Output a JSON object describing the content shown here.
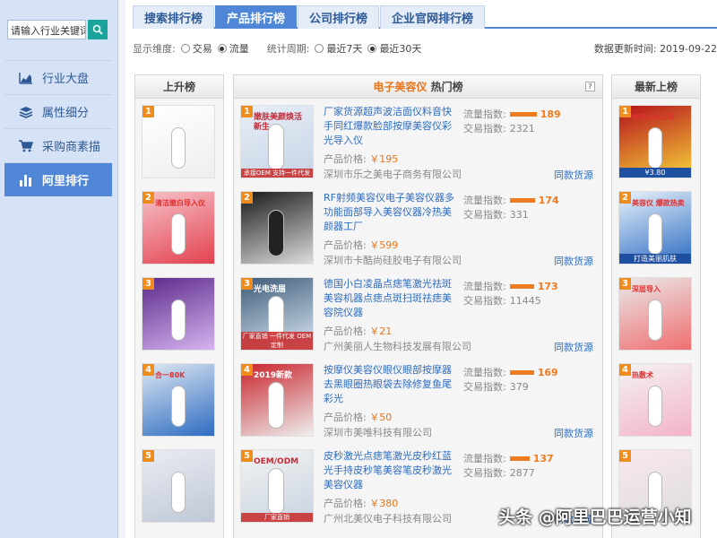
{
  "sidebar": {
    "search_placeholder": "请输入行业关键词",
    "items": [
      {
        "label": "行业大盘",
        "icon": "area-chart-icon"
      },
      {
        "label": "属性细分",
        "icon": "layers-icon"
      },
      {
        "label": "采购商素描",
        "icon": "cart-icon"
      },
      {
        "label": "阿里排行",
        "icon": "bar-chart-icon",
        "active": true
      }
    ]
  },
  "tabs": [
    "搜索排行榜",
    "产品排行榜",
    "公司排行榜",
    "企业官网排行榜"
  ],
  "active_tab": "产品排行榜",
  "filters": {
    "dimension_label": "显示维度:",
    "dimension_options": [
      "交易",
      "流量"
    ],
    "dimension_selected": "流量",
    "period_label": "统计周期:",
    "period_options": [
      "最近7天",
      "最近30天"
    ],
    "period_selected": "最近30天",
    "update_label": "数据更新时间:",
    "update_date": "2019-09-22"
  },
  "columns": {
    "left_title": "上升榜",
    "mid_category": "电子美容仪",
    "mid_title": "热门榜",
    "right_title": "最新上榜",
    "help": "?"
  },
  "products": [
    {
      "rank": "1",
      "title": "厂家货源超声波洁面仪料音快手同红爆款脸部按摩美容仪彩光导入仪",
      "price_label": "产品价格:",
      "price": "￥195",
      "company": "深圳市乐之美电子商务有限公司",
      "traffic_label": "流量指数:",
      "traffic": 189,
      "trade_label": "交易指数:",
      "trade": "2321",
      "source": "同款货源",
      "thumb_text": "嫩肤美颜焕活新生",
      "thumb_caption": "承接OEM 支持一件代发"
    },
    {
      "rank": "2",
      "title": "RF射频美容仪电子美容仪器多功能面部导入美容仪器冷热美颜器工厂",
      "price_label": "产品价格:",
      "price": "￥599",
      "company": "深圳市卡酷尚硅胶电子有限公司",
      "traffic_label": "流量指数:",
      "traffic": 174,
      "trade_label": "交易指数:",
      "trade": "331",
      "source": "同款货源",
      "thumb_text": "",
      "thumb_caption": ""
    },
    {
      "rank": "3",
      "title": "德国小白凌晶点痣笔激光祛斑美容机器点痣点斑扫斑祛痣美容院仪器",
      "price_label": "产品价格:",
      "price": "￥21",
      "company": "广州美丽人生物科技发展有限公司",
      "traffic_label": "流量指数:",
      "traffic": 173,
      "trade_label": "交易指数:",
      "trade": "11445",
      "source": "同款货源",
      "thumb_text": "光电洗眉",
      "thumb_caption": "厂家直销 一件代发 OEM定制"
    },
    {
      "rank": "4",
      "title": "按摩仪美容仪眼仪眼部按摩器去黑眼圈热眼袋去除修复鱼尾彩光",
      "price_label": "产品价格:",
      "price": "￥50",
      "company": "深圳市美唯科技有限公司",
      "traffic_label": "流量指数:",
      "traffic": 169,
      "trade_label": "交易指数:",
      "trade": "379",
      "source": "同款货源",
      "thumb_text": "2019新款",
      "thumb_caption": ""
    },
    {
      "rank": "5",
      "title": "皮秒激光点痣笔激光皮秒红蓝光手持皮秒笔美容笔皮秒激光美容仪器",
      "price_label": "产品价格:",
      "price": "￥380",
      "company": "广州北美仪电子科技有限公司",
      "traffic_label": "流量指数:",
      "traffic": 137,
      "trade_label": "交易指数:",
      "trade": "2877",
      "source": "同款货源",
      "thumb_text": "OEM/ODM",
      "thumb_caption": "厂家直销"
    }
  ],
  "left_items": [
    {
      "rank": "1",
      "text": ""
    },
    {
      "rank": "2",
      "text": "清洁嫩白导入仪"
    },
    {
      "rank": "3",
      "text": ""
    },
    {
      "rank": "4",
      "text": "合一80K"
    },
    {
      "rank": "5",
      "text": ""
    }
  ],
  "right_items": [
    {
      "rank": "1",
      "text": "WDIAN五电",
      "badge": "¥3.80"
    },
    {
      "rank": "2",
      "text": "美容仪 爆款热卖",
      "badge": "打造美丽肌肤"
    },
    {
      "rank": "3",
      "text": "深层导入"
    },
    {
      "rank": "4",
      "text": "热敷术"
    },
    {
      "rank": "5",
      "text": ""
    }
  ],
  "watermark": "头条 @阿里巴巴运营小知",
  "colors": {
    "accent": "#4f86d6",
    "orange": "#f07a1e",
    "link": "#2d6cc2"
  }
}
